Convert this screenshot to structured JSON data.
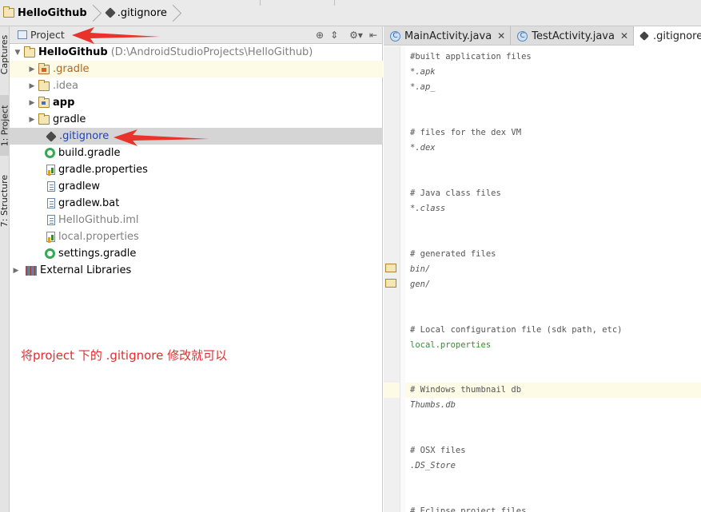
{
  "breadcrumb": {
    "project": "HelloGithub",
    "file": ".gitignore"
  },
  "left_strip": {
    "captures": "Captures",
    "project": "1: Project",
    "structure": "7: Structure"
  },
  "project_panel": {
    "title": "Project",
    "tree": {
      "root_name": "HelloGithub",
      "root_path": "(D:\\AndroidStudioProjects\\HelloGithub)",
      "items": [
        {
          "label": ".gradle"
        },
        {
          "label": ".idea"
        },
        {
          "label": "app"
        },
        {
          "label": "gradle"
        },
        {
          "label": ".gitignore"
        },
        {
          "label": "build.gradle"
        },
        {
          "label": "gradle.properties"
        },
        {
          "label": "gradlew"
        },
        {
          "label": "gradlew.bat"
        },
        {
          "label": "HelloGithub.iml"
        },
        {
          "label": "local.properties"
        },
        {
          "label": "settings.gradle"
        }
      ],
      "external": "External Libraries"
    },
    "annotation": "将project 下的 .gitignore  修改就可以"
  },
  "editor": {
    "tabs": [
      {
        "label": "MainActivity.java",
        "icon": "C"
      },
      {
        "label": "TestActivity.java",
        "icon": "C"
      },
      {
        "label": ".gitignore"
      }
    ],
    "lines": [
      "#built application files",
      "*.apk",
      "*.ap_",
      "# files for the dex VM",
      "*.dex",
      "# Java class files",
      "*.class",
      "# generated files",
      "bin/",
      "gen/",
      "# Local configuration file (sdk path, etc)",
      "local.properties",
      "# Windows thumbnail db",
      "Thumbs.db",
      "# OSX files",
      ".DS_Store",
      "# Eclipse project files"
    ]
  },
  "colors": {
    "annotation_red": "#e22d2d",
    "selection": "#d5d5d5",
    "caret_row": "#fdfbe6"
  }
}
